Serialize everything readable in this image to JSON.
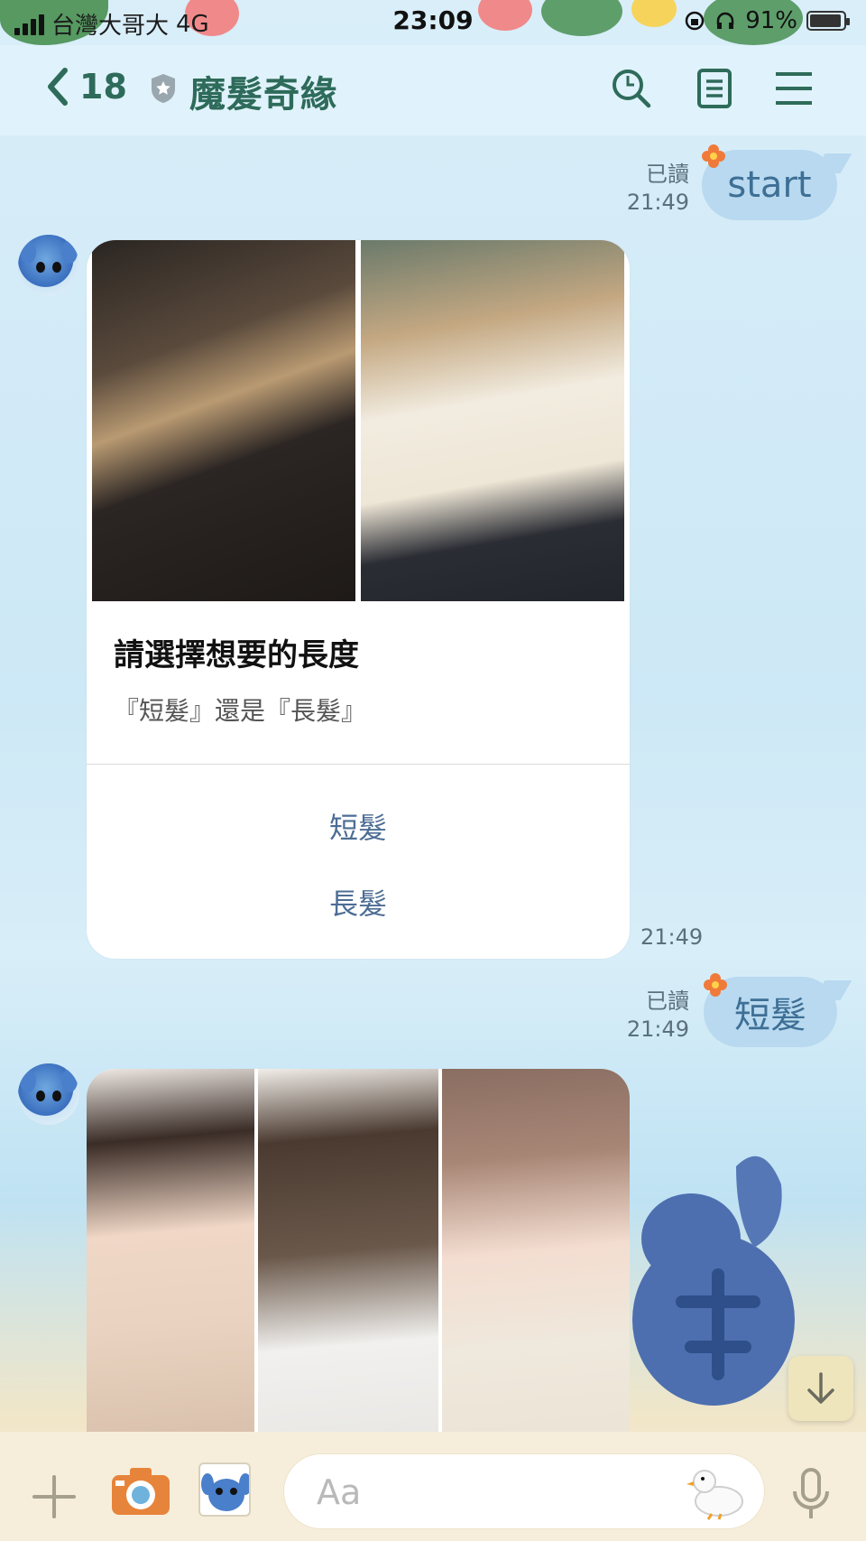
{
  "status_bar": {
    "carrier": "台灣大哥大",
    "network": "4G",
    "time": "23:09",
    "battery": "91%"
  },
  "header": {
    "back_count": "18",
    "title": "魔髮奇緣"
  },
  "messages": [
    {
      "type": "outgoing",
      "text": "start",
      "read": "已讀",
      "time": "21:49"
    },
    {
      "type": "card",
      "title": "請選擇想要的長度",
      "subtitle": "『短髮』還是『長髮』",
      "actions": [
        "短髮",
        "長髮"
      ],
      "time": "21:49"
    },
    {
      "type": "outgoing",
      "text": "短髮",
      "read": "已讀",
      "time": "21:49"
    }
  ],
  "composer": {
    "placeholder": "Aa"
  },
  "colors": {
    "accent": "#2e6b5a",
    "bubble": "#b8d9ef",
    "link": "#4d6d94"
  }
}
